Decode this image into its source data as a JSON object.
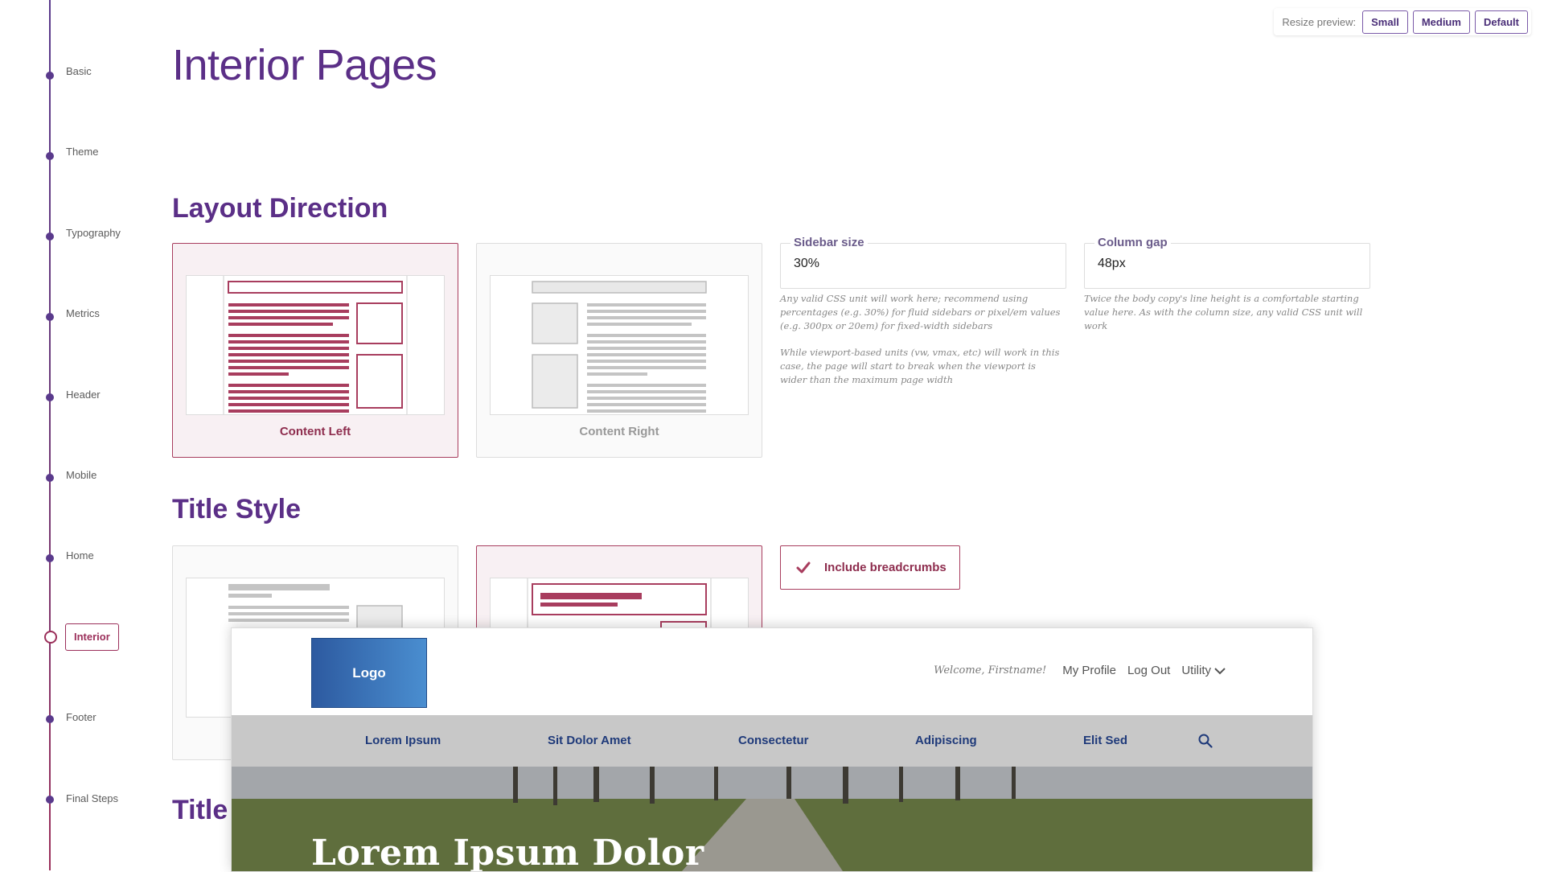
{
  "nav": {
    "items": [
      {
        "label": "Basic"
      },
      {
        "label": "Theme"
      },
      {
        "label": "Typography"
      },
      {
        "label": "Metrics"
      },
      {
        "label": "Header"
      },
      {
        "label": "Mobile"
      },
      {
        "label": "Home"
      },
      {
        "label": "Interior",
        "active": true
      },
      {
        "label": "Footer"
      },
      {
        "label": "Final Steps"
      }
    ]
  },
  "resize": {
    "label": "Resize preview:",
    "buttons": [
      "Small",
      "Medium",
      "Default"
    ]
  },
  "page_title": "Interior Pages",
  "layout_direction": {
    "title": "Layout Direction",
    "options": [
      {
        "label": "Content Left",
        "selected": true
      },
      {
        "label": "Content Right",
        "selected": false
      }
    ],
    "sidebar_size": {
      "label": "Sidebar size",
      "value": "30%",
      "help1": "Any valid CSS unit will work here; recommend using percentages (e.g. 30%) for fluid sidebars or pixel/em values (e.g. 300px or 20em) for fixed-width sidebars",
      "help2": "While viewport-based units (vw, vmax, etc) will work in this case, the page will start to break when the viewport is wider than the maximum page width"
    },
    "column_gap": {
      "label": "Column gap",
      "value": "48px",
      "help": "Twice the body copy's line height is a comfortable starting value here. As with the column size, any valid CSS unit will work"
    }
  },
  "title_style": {
    "title": "Title Style",
    "breadcrumbs_label": "Include breadcrumbs",
    "breadcrumbs_checked": true
  },
  "partial_section_title": "Title",
  "colors": {
    "accent_purple": "#5b2f87",
    "accent_crimson": "#a83d5e",
    "preview_nav_text": "#1f3a7a"
  },
  "preview": {
    "logo": "Logo",
    "welcome": "Welcome, Firstname!",
    "util_links": [
      "My Profile",
      "Log Out",
      "Utility"
    ],
    "nav_items": [
      "Lorem Ipsum",
      "Sit Dolor Amet",
      "Consectetur",
      "Adipiscing",
      "Elit Sed"
    ],
    "hero_title": "Lorem Ipsum Dolor"
  }
}
